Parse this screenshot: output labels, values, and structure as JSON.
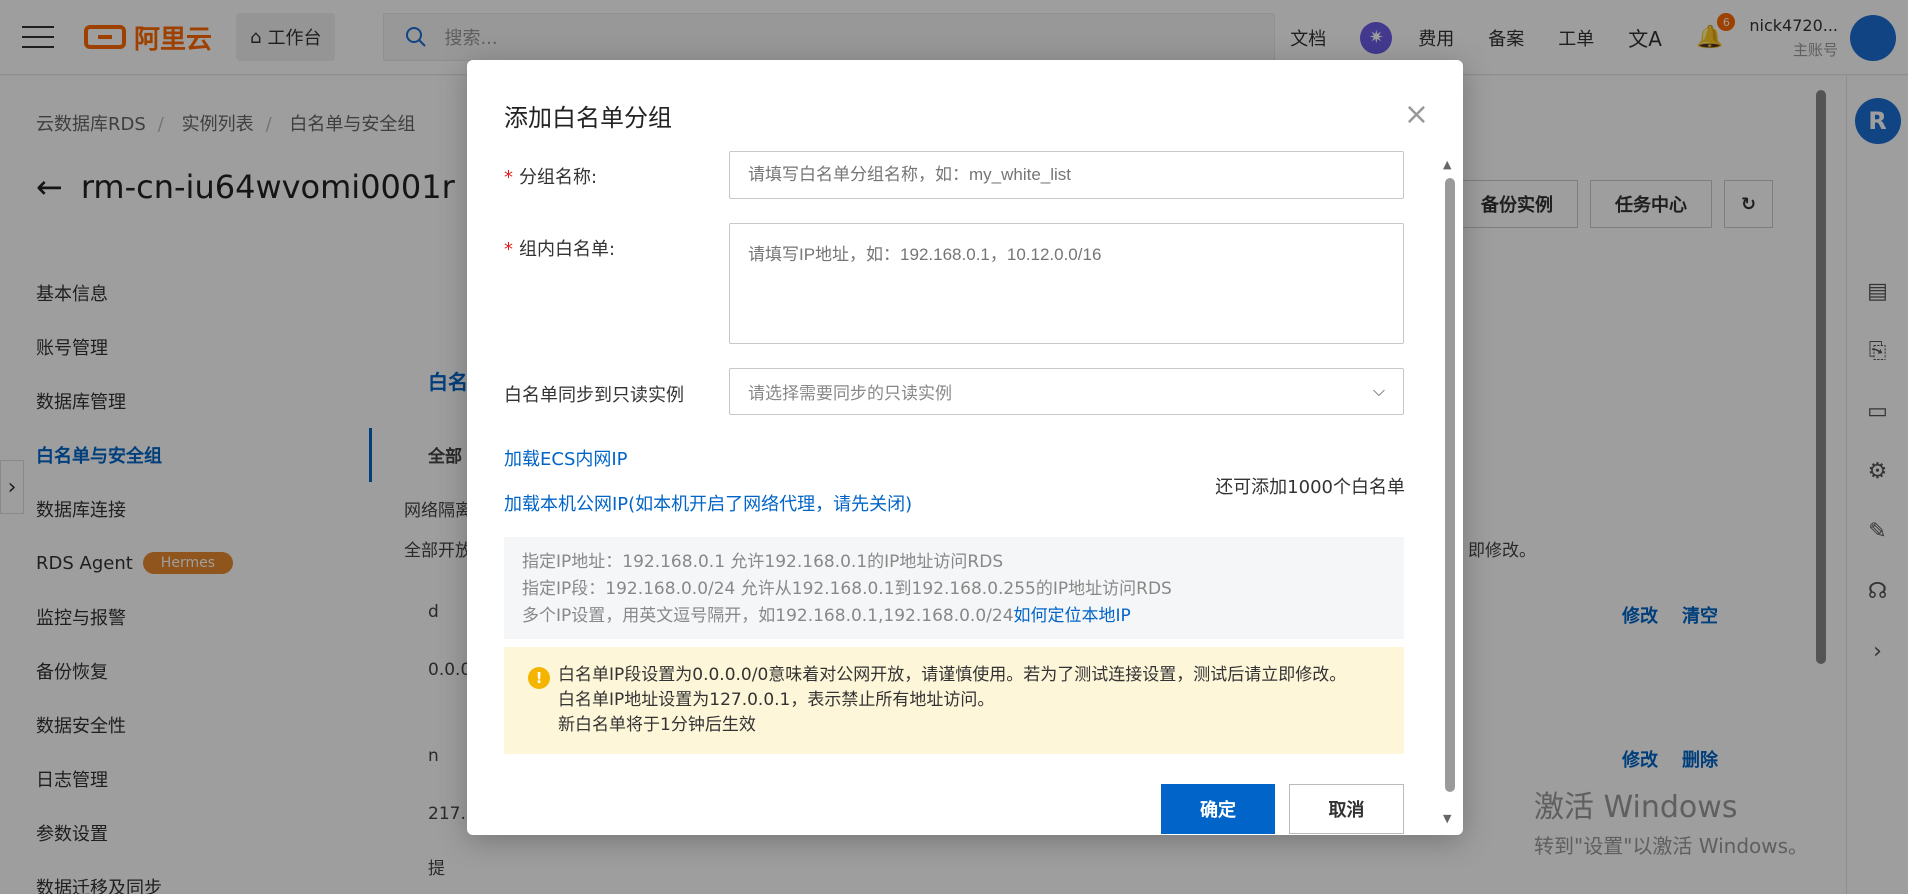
{
  "topbar": {
    "logo_text": "阿里云",
    "workbench": "工作台",
    "search_placeholder": "搜索...",
    "docs": "文档",
    "billing": "费用",
    "icp": "备案",
    "ticket": "工单",
    "notification_count": "6",
    "username": "nick4720...",
    "account_type": "主账号"
  },
  "breadcrumb": [
    "云数据库RDS",
    "实例列表",
    "白名单与安全组"
  ],
  "page_title": "rm-cn-iu64wvomi0001r",
  "title_actions": [
    "备份实例",
    "任务中心"
  ],
  "sidebar": {
    "items": [
      {
        "label": "基本信息"
      },
      {
        "label": "账号管理"
      },
      {
        "label": "数据库管理"
      },
      {
        "label": "白名单与安全组"
      },
      {
        "label": "数据库连接"
      },
      {
        "label": "RDS Agent",
        "badge": "Hermes"
      },
      {
        "label": "监控与报警"
      },
      {
        "label": "备份恢复"
      },
      {
        "label": "数据安全性"
      },
      {
        "label": "日志管理"
      },
      {
        "label": "参数设置"
      },
      {
        "label": "数据迁移及同步"
      }
    ]
  },
  "background": {
    "tab_partial": "白名",
    "filter_partial": "全部",
    "network_partial": "网络隔离",
    "open_partial": "全部开放",
    "modify_tail": "即修改。",
    "row1_partial": "d",
    "row1_ip": "0.0.0.",
    "row2_partial": "n",
    "row2_ip": "217.2",
    "modify": "修改",
    "clear": "清空",
    "delete": "删除",
    "notice_partial": "提"
  },
  "watermark": {
    "line1": "激活 Windows",
    "line2": "转到\"设置\"以激活 Windows。"
  },
  "dialog": {
    "title": "添加白名单分组",
    "group_name_label": "分组名称:",
    "group_name_placeholder": "请填写白名单分组名称，如：my_white_list",
    "whitelist_label": "组内白名单:",
    "whitelist_placeholder": "请填写IP地址，如：192.168.0.1，10.12.0.0/16",
    "sync_label": "白名单同步到只读实例",
    "sync_placeholder": "请选择需要同步的只读实例",
    "load_ecs": "加载ECS内网IP",
    "load_public": "加载本机公网IP(如本机开启了网络代理，请先关闭)",
    "remaining": "还可添加1000个白名单",
    "hint_line1": "指定IP地址：192.168.0.1 允许192.168.0.1的IP地址访问RDS",
    "hint_line2": "指定IP段：192.168.0.0/24 允许从192.168.0.1到192.168.0.255的IP地址访问RDS",
    "hint_line3": "多个IP设置，用英文逗号隔开，如192.168.0.1,192.168.0.0/24",
    "hint_link": "如何定位本地IP",
    "warn_line1": "白名单IP段设置为0.0.0.0/0意味着对公网开放，请谨慎使用。若为了测试连接设置，测试后请立即修改。",
    "warn_line2": "白名单IP地址设置为127.0.0.1，表示禁止所有地址访问。",
    "warn_line3": "新白名单将于1分钟后生效",
    "ok": "确定",
    "cancel": "取消"
  }
}
